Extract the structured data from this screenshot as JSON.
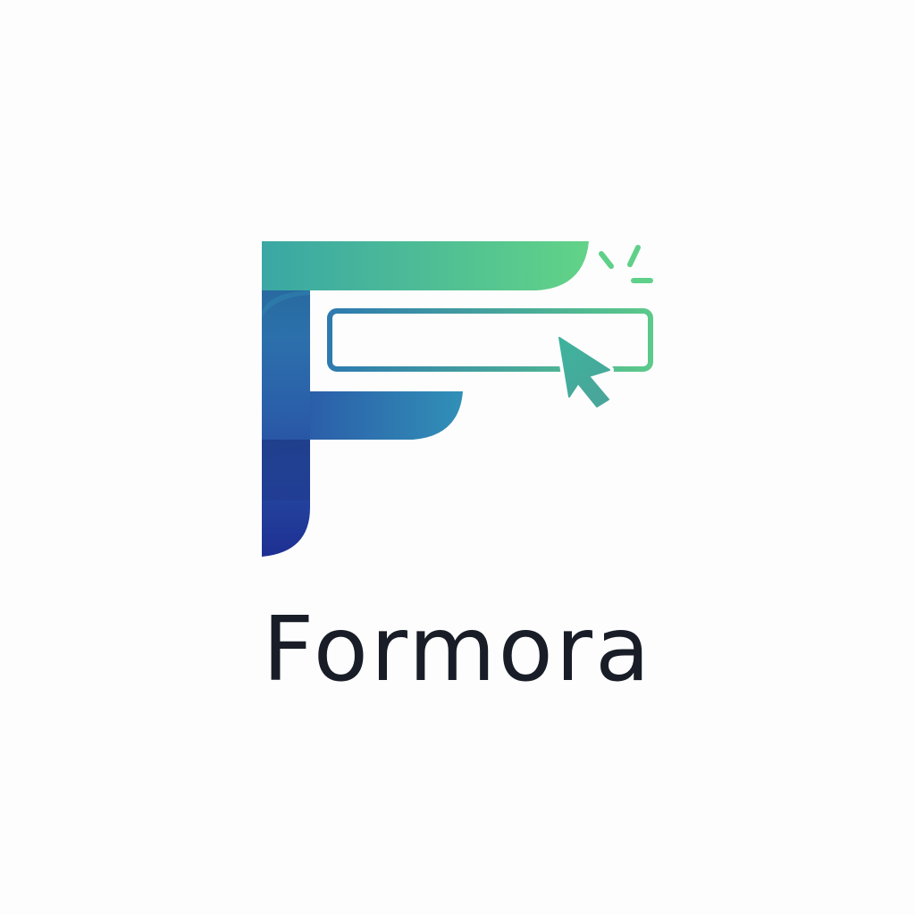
{
  "brand": {
    "name": "Formora",
    "colors": {
      "gradient_teal": "#3bb3a0",
      "gradient_green": "#62d387",
      "gradient_blue": "#2c68ad",
      "gradient_navy": "#1e2f93",
      "text": "#181d27",
      "background": "#fdfdfd"
    }
  },
  "icons": {
    "letter": "letter-f-icon",
    "field": "input-field-icon",
    "cursor": "cursor-arrow-icon",
    "spark": "click-spark-icon"
  }
}
